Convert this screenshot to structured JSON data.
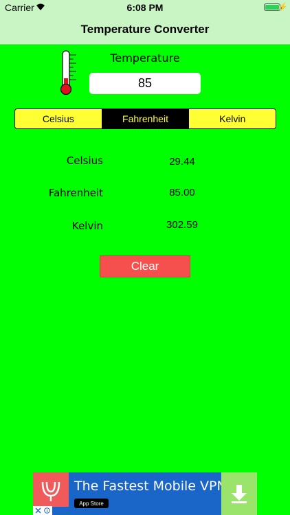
{
  "status_bar": {
    "carrier": "Carrier",
    "time": "6:08 PM"
  },
  "nav": {
    "title": "Temperature Converter"
  },
  "input": {
    "label": "Temperature",
    "value": "85"
  },
  "units": {
    "options": [
      "Celsius",
      "Fahrenheit",
      "Kelvin"
    ],
    "selected": "Fahrenheit"
  },
  "results": [
    {
      "label": "Celsius",
      "value": "29.44"
    },
    {
      "label": "Fahrenheit",
      "value": "85.00"
    },
    {
      "label": "Kelvin",
      "value": "302.59"
    }
  ],
  "clear_label": "Clear",
  "ad": {
    "title": "The Fastest Mobile VPN",
    "store_badge": "App Store"
  },
  "colors": {
    "background": "#00ff00",
    "bar": "#c8f5c3",
    "segment": "#ffff33",
    "clear": "#f5504d"
  }
}
